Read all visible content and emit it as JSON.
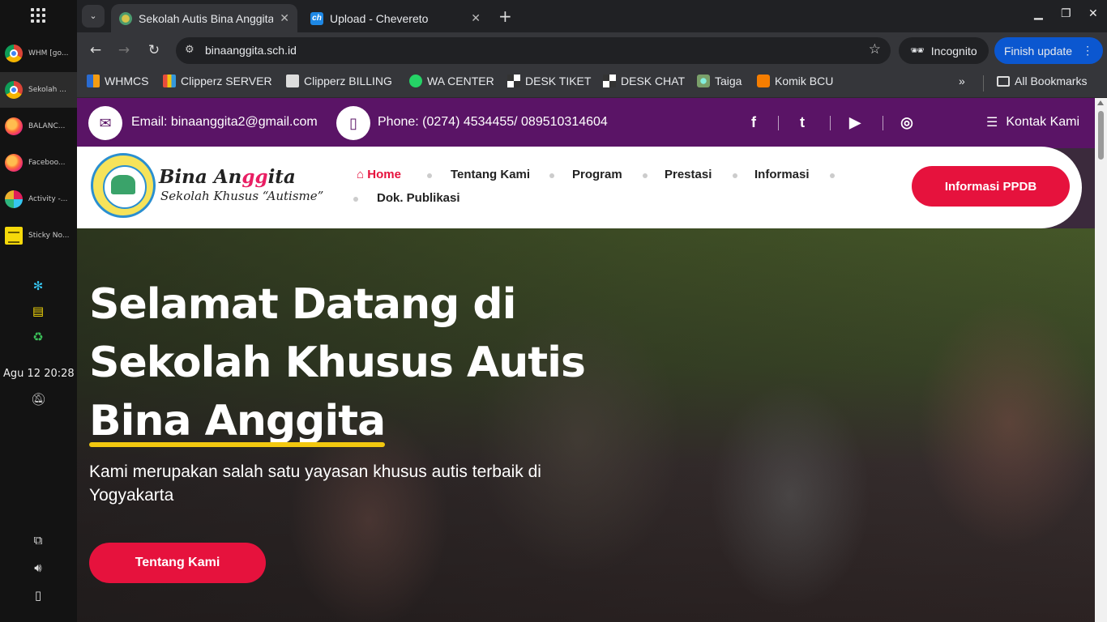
{
  "dock": {
    "tasks": [
      {
        "label": "WHM [go..."
      },
      {
        "label": "Sekolah ..."
      },
      {
        "label": "BALANC..."
      },
      {
        "label": "Faceboo..."
      },
      {
        "label": "Activity -..."
      },
      {
        "label": "Sticky No..."
      }
    ],
    "clock": "Agu 12  20:28"
  },
  "browser": {
    "tabs": [
      {
        "title": "Sekolah Autis Bina Anggita",
        "icon": "school-favicon"
      },
      {
        "title": "Upload - Chevereto",
        "icon": "chevereto-favicon",
        "icon_text": "ch"
      }
    ],
    "url": "binaanggita.sch.id",
    "incognito_label": "Incognito",
    "update_label": "Finish update",
    "bookmarks": [
      {
        "label": "WHMCS"
      },
      {
        "label": "Clipperz SERVER"
      },
      {
        "label": "Clipperz BILLING"
      },
      {
        "label": "WA CENTER"
      },
      {
        "label": "DESK TIKET"
      },
      {
        "label": "DESK CHAT"
      },
      {
        "label": "Taiga"
      },
      {
        "label": "Komik BCU"
      }
    ],
    "all_bookmarks_label": "All Bookmarks"
  },
  "site": {
    "topbar": {
      "email": "Email: binaanggita2@gmail.com",
      "phone": "Phone: (0274) 4534455/ 089510314604",
      "social": [
        "facebook",
        "twitter",
        "youtube",
        "instagram"
      ],
      "social_glyphs": [
        "f",
        "t",
        "▶",
        "◎"
      ],
      "contact_label": "Kontak Kami"
    },
    "brand": {
      "name_part1": "Bina An",
      "name_part2": "gg",
      "name_part3": "ita",
      "tagline": "Sekolah Khusus “Autisme”"
    },
    "menu": [
      "Home",
      "Tentang Kami",
      "Program",
      "Prestasi",
      "Informasi",
      "Dok. Publikasi"
    ],
    "ppdb_label": "Informasi PPDB",
    "hero": {
      "title_line1": "Selamat Datang di",
      "title_line2": "Sekolah Khusus Autis",
      "title_line3": "Bina Anggita",
      "subtitle": "Kami merupakan salah satu yayasan khusus autis terbaik di Yogyakarta",
      "button_label": "Tentang Kami"
    }
  },
  "colors": {
    "brand_purple": "#5a1466",
    "brand_red": "#e6123d",
    "highlight_yellow": "#f2c80f"
  }
}
